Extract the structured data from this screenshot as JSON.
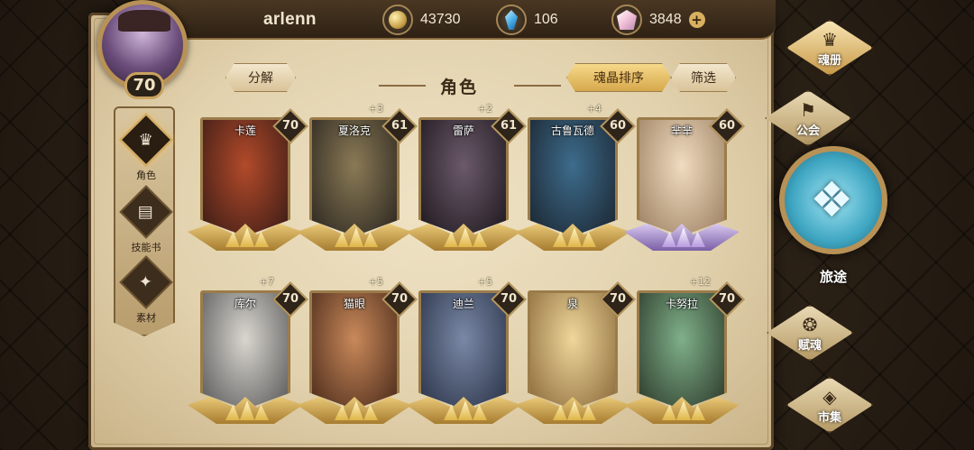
{
  "player": {
    "name": "arlenn",
    "level": "70"
  },
  "resources": [
    {
      "icon": "gold-coin-icon",
      "value": "43730"
    },
    {
      "icon": "blue-crystal-icon",
      "value": "106"
    },
    {
      "icon": "soul-crystal-icon",
      "value": "3848"
    }
  ],
  "header": {
    "title": "角色",
    "decompose": "分解",
    "sort": "魂晶排序",
    "filter": "筛选"
  },
  "leftnav": [
    {
      "label": "角色",
      "icon": "character-icon"
    },
    {
      "label": "技能书",
      "icon": "skill-book-icon"
    },
    {
      "label": "素材",
      "icon": "material-icon"
    }
  ],
  "cards": [
    {
      "name": "卡莲",
      "level": "70",
      "bonus": "",
      "colors": [
        "#b24a2a",
        "#3b1c16"
      ]
    },
    {
      "name": "夏洛克",
      "level": "61",
      "bonus": "+3",
      "colors": [
        "#8a7a55",
        "#2b2620"
      ]
    },
    {
      "name": "雷萨",
      "level": "61",
      "bonus": "+2",
      "colors": [
        "#6b5a6a",
        "#1e181e"
      ]
    },
    {
      "name": "古鲁瓦德",
      "level": "60",
      "bonus": "+4",
      "colors": [
        "#3d6c8c",
        "#1b2530"
      ]
    },
    {
      "name": "芈芈",
      "level": "60",
      "bonus": "",
      "colors": [
        "#f0dcc0",
        "#9c7f62"
      ]
    },
    {
      "name": "库尔",
      "level": "70",
      "bonus": "+7",
      "colors": [
        "#d9d6cf",
        "#5a5a5a"
      ]
    },
    {
      "name": "猫眼",
      "level": "70",
      "bonus": "+5",
      "colors": [
        "#c9895a",
        "#4a2a1a"
      ]
    },
    {
      "name": "迪兰",
      "level": "70",
      "bonus": "+5",
      "colors": [
        "#7a88a6",
        "#2a3348"
      ]
    },
    {
      "name": "泉",
      "level": "70",
      "bonus": "",
      "colors": [
        "#efd69a",
        "#8a6a3a"
      ]
    },
    {
      "name": "卡努拉",
      "level": "70",
      "bonus": "+12",
      "colors": [
        "#7fb08a",
        "#2d3a2a"
      ]
    }
  ],
  "rightmenu": [
    {
      "label": "魂册",
      "icon": "soul-book-icon"
    },
    {
      "label": "公会",
      "icon": "guild-icon"
    },
    {
      "label": "旅途",
      "icon": "journey-icon"
    },
    {
      "label": "赋魂",
      "icon": "soul-infuse-icon"
    },
    {
      "label": "市集",
      "icon": "market-icon"
    }
  ]
}
